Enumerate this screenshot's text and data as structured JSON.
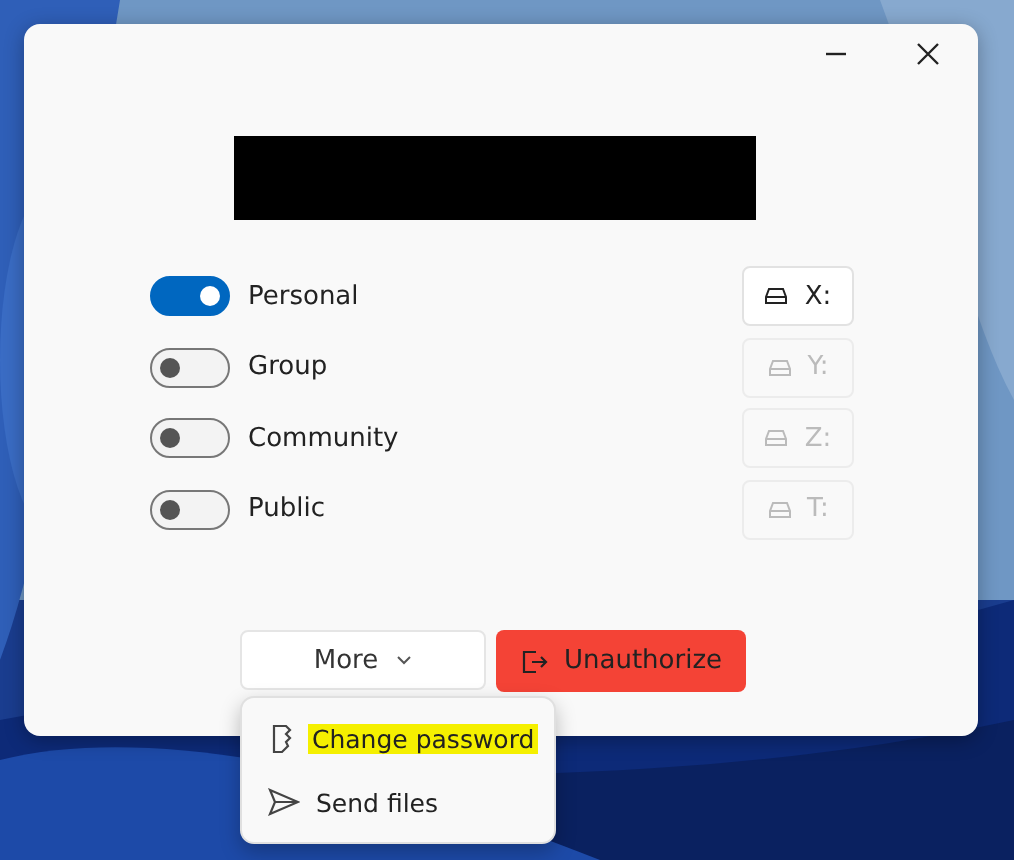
{
  "window": {
    "controls": [
      {
        "kind": "minimize"
      },
      {
        "kind": "close"
      }
    ]
  },
  "redacted_title": {
    "kind": "redaction"
  },
  "rows": [
    {
      "label": "Personal",
      "on": true,
      "drive": {
        "letter": "X:",
        "disabled": false
      }
    },
    {
      "label": "Group",
      "on": false,
      "drive": {
        "letter": "Y:",
        "disabled": true
      }
    },
    {
      "label": "Community",
      "on": false,
      "drive": {
        "letter": "Z:",
        "disabled": true
      }
    },
    {
      "label": "Public",
      "on": false,
      "drive": {
        "letter": "T:",
        "disabled": true
      }
    }
  ],
  "more_button": {
    "label": "More",
    "expanded": true
  },
  "unauthorize_button": {
    "label": "Unauthorize"
  },
  "menu": [
    {
      "label": "Change password",
      "kind": "key",
      "highlighted": true
    },
    {
      "label": "Send files",
      "kind": "send",
      "highlighted": false
    }
  ]
}
